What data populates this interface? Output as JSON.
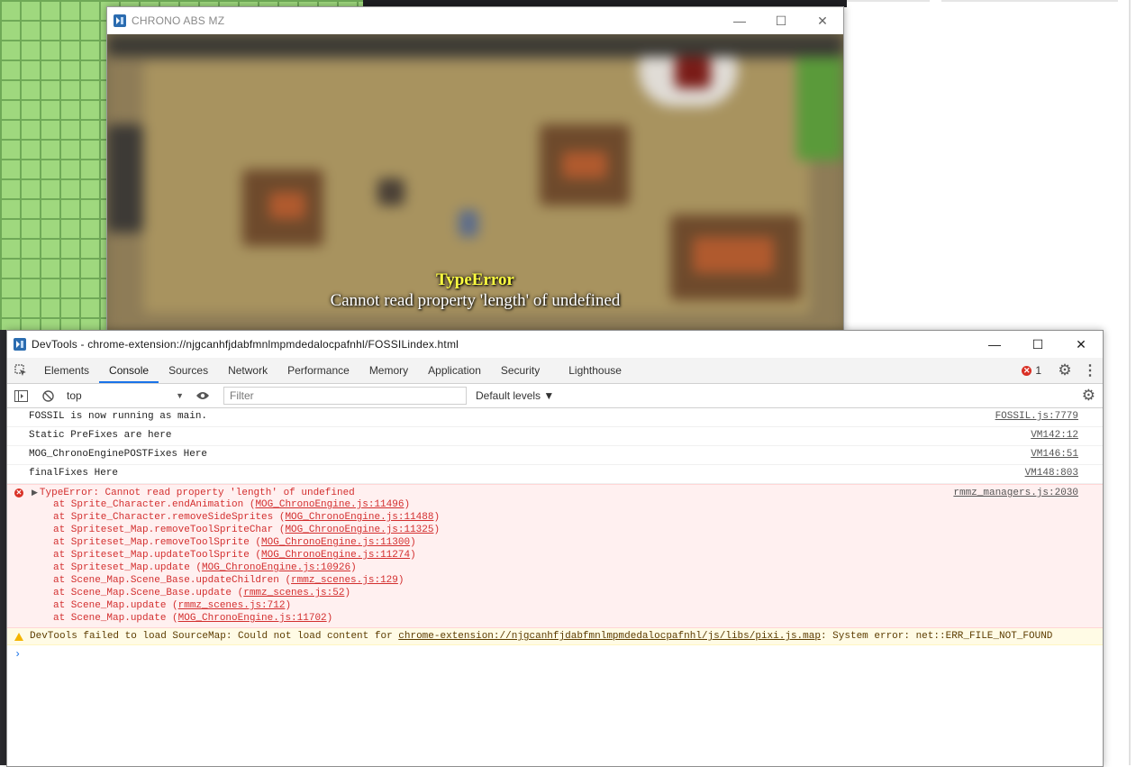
{
  "game_window": {
    "title": "CHRONO ABS MZ",
    "minimize": "—",
    "maximize": "☐",
    "close": "✕",
    "error_title": "TypeError",
    "error_message": "Cannot read property 'length' of undefined"
  },
  "devtools": {
    "title": "DevTools - chrome-extension://njgcanhfjdabfmnlmpmdedalocpafnhl/FOSSILindex.html",
    "minimize": "—",
    "maximize": "☐",
    "close": "✕",
    "tabs": [
      "Elements",
      "Console",
      "Sources",
      "Network",
      "Performance",
      "Memory",
      "Application",
      "Security",
      "Lighthouse"
    ],
    "active_tab": "Console",
    "error_count": "1",
    "context": "top",
    "filter_placeholder": "Filter",
    "levels_label": "Default levels ▼",
    "logs": [
      {
        "text": "FOSSIL is now running as main.",
        "source": "FOSSIL.js:7779"
      },
      {
        "text": "Static PreFixes are here",
        "source": "VM142:12"
      },
      {
        "text": "MOG_ChronoEnginePOSTFixes Here",
        "source": "VM146:51"
      },
      {
        "text": "finalFixes Here",
        "source": "VM148:803"
      }
    ],
    "error": {
      "head": "TypeError: Cannot read property 'length' of undefined",
      "source": "rmmz_managers.js:2030",
      "stack": [
        {
          "prefix": "at Sprite_Character.endAnimation (",
          "link": "MOG_ChronoEngine.js:11496",
          "suffix": ")"
        },
        {
          "prefix": "at Sprite_Character.removeSideSprites (",
          "link": "MOG_ChronoEngine.js:11488",
          "suffix": ")"
        },
        {
          "prefix": "at Spriteset_Map.removeToolSpriteChar (",
          "link": "MOG_ChronoEngine.js:11325",
          "suffix": ")"
        },
        {
          "prefix": "at Spriteset_Map.removeToolSprite (",
          "link": "MOG_ChronoEngine.js:11300",
          "suffix": ")"
        },
        {
          "prefix": "at Spriteset_Map.updateToolSprite (",
          "link": "MOG_ChronoEngine.js:11274",
          "suffix": ")"
        },
        {
          "prefix": "at Spriteset_Map.update (",
          "link": "MOG_ChronoEngine.js:10926",
          "suffix": ")"
        },
        {
          "prefix": "at Scene_Map.Scene_Base.updateChildren (",
          "link": "rmmz_scenes.js:129",
          "suffix": ")"
        },
        {
          "prefix": "at Scene_Map.Scene_Base.update (",
          "link": "rmmz_scenes.js:52",
          "suffix": ")"
        },
        {
          "prefix": "at Scene_Map.update (",
          "link": "rmmz_scenes.js:712",
          "suffix": ")"
        },
        {
          "prefix": "at Scene_Map.update (",
          "link": "MOG_ChronoEngine.js:11702",
          "suffix": ")"
        }
      ]
    },
    "warning": {
      "prefix": "DevTools failed to load SourceMap: Could not load content for ",
      "link": "chrome-extension://njgcanhfjdabfmnlmpmdedalocpafnhl/js/libs/pixi.js.map",
      "suffix": ": System error: net::ERR_FILE_NOT_FOUND"
    },
    "prompt": "›"
  }
}
